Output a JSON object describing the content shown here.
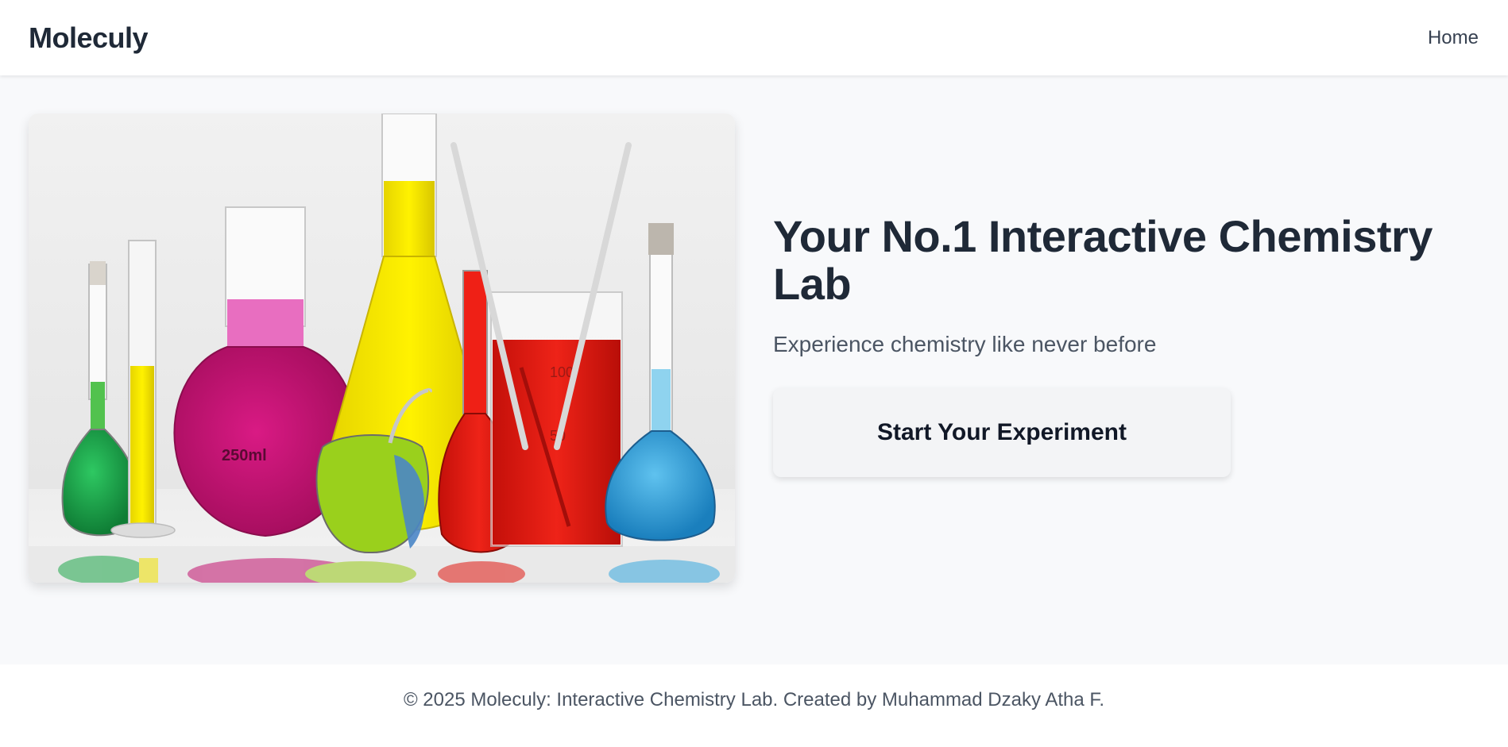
{
  "nav": {
    "brand": "Moleculy",
    "links": [
      {
        "label": "Home"
      }
    ]
  },
  "hero": {
    "image_description_icon": "chemistry-glassware-photo",
    "flask_label": "250ml",
    "beaker_marks": [
      "100",
      "50"
    ],
    "title": "Your No.1 Interactive Chemistry Lab",
    "subtitle": "Experience chemistry like never before",
    "cta_label": "Start Your Experiment"
  },
  "footer": {
    "text": "© 2025 Moleculy: Interactive Chemistry Lab. Created by Muhammad Dzaky Atha F."
  },
  "colors": {
    "text_dark": "#1f2937",
    "text_muted": "#4b5563",
    "background": "#f8f9fb",
    "button_bg": "#f3f4f6",
    "liquid_green": "#1fa84a",
    "liquid_yellow": "#f2e200",
    "liquid_magenta": "#c2126f",
    "liquid_red": "#e01a12",
    "liquid_blue": "#36a8df"
  }
}
